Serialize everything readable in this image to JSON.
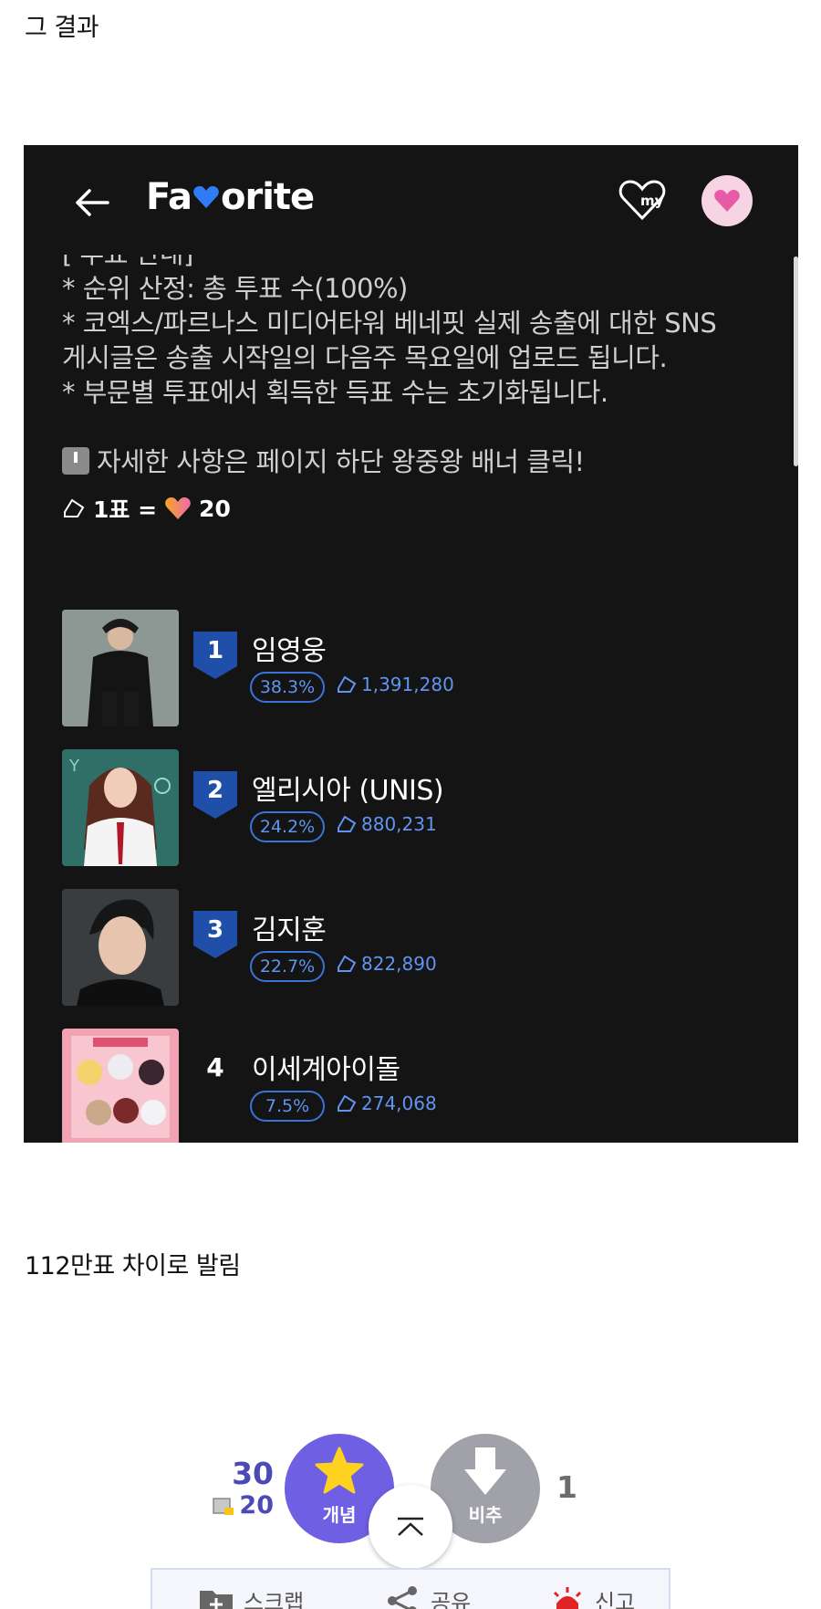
{
  "post": {
    "line1": "그 결과",
    "line2": "112만표 차이로 발림"
  },
  "app": {
    "logo_prefix": "Fa",
    "logo_suffix": "orite",
    "my_label": "my",
    "desc_cut": "[ 투표 안내]",
    "desc_lines": [
      "* 순위 산정: 총 투표 수(100%)",
      "* 코엑스/파르나스 미디어타워 베네핏 실제 송출에 대한 SNS",
      "게시글은 송출 시작일의 다음주 목요일에 업로드 됩니다.",
      "* 부문별 투표에서 획득한 득표 수는 초기화됩니다."
    ],
    "banner_note": "자세한 사항은 페이지 하단 왕중왕 배너 클릭!",
    "rate_left": "1표 =",
    "rate_right": "20",
    "rankings": [
      {
        "rank": "1",
        "name": "임영웅",
        "percent": "38.3%",
        "votes": "1,391,280"
      },
      {
        "rank": "2",
        "name": "엘리시아 (UNIS)",
        "percent": "24.2%",
        "votes": "880,231"
      },
      {
        "rank": "3",
        "name": "김지훈",
        "percent": "22.7%",
        "votes": "822,890"
      },
      {
        "rank": "4",
        "name": "이세계아이돌",
        "percent": "7.5%",
        "votes": "274,068"
      }
    ],
    "colors": {
      "badge": "#1f4fa8",
      "accent": "#5f95f0",
      "background": "#141414"
    }
  },
  "reactions": {
    "recommend_count": "30",
    "sub_count": "20",
    "recommend_label": "개념",
    "downvote_label": "비추",
    "downvote_count": "1"
  },
  "actions": {
    "scrap": "스크랩",
    "share": "공유",
    "report": "신고"
  }
}
